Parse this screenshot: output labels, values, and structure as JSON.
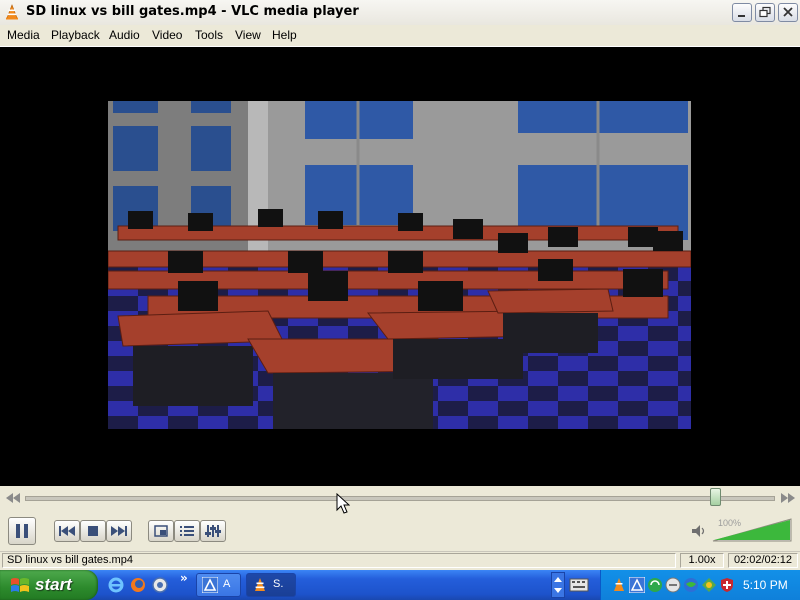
{
  "window": {
    "title": "SD linux vs bill gates.mp4 - VLC media player",
    "minimize_icon": "minimize-icon",
    "restore_icon": "restore-icon",
    "close_icon": "close-icon"
  },
  "menu": {
    "items": [
      "Media",
      "Playback",
      "Audio",
      "Video",
      "Tools",
      "View",
      "Help"
    ]
  },
  "player": {
    "seek_position_fraction": 0.92,
    "volume_label": "100%",
    "volume_fraction": 1.0,
    "play_state": "playing",
    "buttons": {
      "pause": "pause-icon",
      "previous": "previous-icon",
      "stop": "stop-icon",
      "next": "next-icon",
      "fullscreen": "fullscreen-icon",
      "playlist": "playlist-icon",
      "extended": "equalizer-icon"
    }
  },
  "status": {
    "filename": "SD linux vs bill gates.mp4",
    "speed": "1.00x",
    "time": "02:02/02:12"
  },
  "taskbar": {
    "start_label": "start",
    "tasks": [
      {
        "label": "A",
        "icon": "app-icon"
      },
      {
        "label": "S.",
        "icon": "vlc-icon"
      }
    ],
    "clock": "5:10 PM"
  },
  "colors": {
    "vlc_orange": "#f28a1c",
    "taskbar_blue": "#245edb",
    "start_green": "#2c8a2c",
    "seek_handle_green": "#a6d0a2",
    "volume_green": "#3cb83c"
  }
}
